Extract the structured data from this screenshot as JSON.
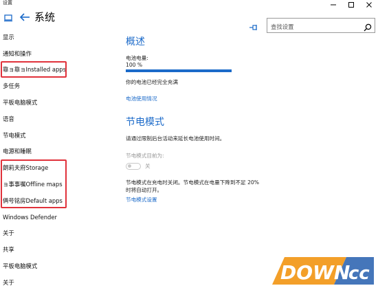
{
  "window": {
    "title": "设置"
  },
  "header": {
    "title": "系统",
    "search_placeholder": "查找设置"
  },
  "nav": {
    "items": [
      "显示",
      "通知和操作",
      "靠ョ靠ョInstalled apps",
      "多任务",
      "平板电脑模式",
      "语音",
      "节电模式",
      "电源和睡眠",
      "朗莉夫府Storage",
      "ョ事事嘱Offline maps",
      "俩号铭房Default apps",
      "Windows Defender",
      "关于",
      "共享",
      "平板电脑模式",
      "关于"
    ]
  },
  "overview": {
    "heading": "概述",
    "battery_label": "电池电量:",
    "battery_value": "100 %",
    "battery_percent": 100,
    "status": "你的电池已经完全充满",
    "usage_link": "电池使用情况"
  },
  "saver": {
    "heading": "节电模式",
    "description": "请通过限制后台活动来延长电池使用时间。",
    "current_label": "节电模式目前为:",
    "toggle_state": "关",
    "toggle_on": false,
    "auto_text": "节电模式在充电时关闭。节电模式在电量下降到不足 20% 时将自动打开。",
    "settings_link": "节电模式设置"
  },
  "watermark": {
    "text": "DOWN.cc"
  },
  "colors": {
    "accent": "#1b6ac9",
    "highlight": "#e0313a"
  }
}
